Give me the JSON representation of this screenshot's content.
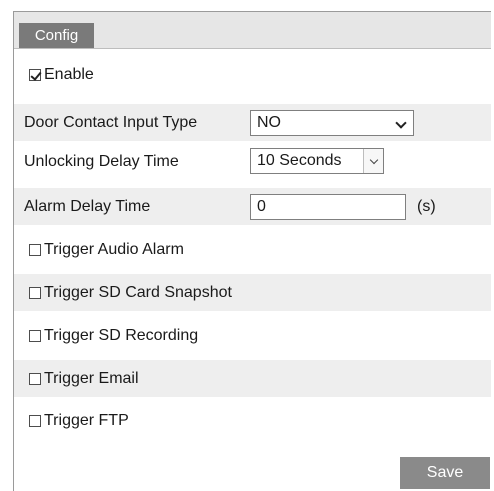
{
  "tab": {
    "label": "Config"
  },
  "enable": {
    "label": "Enable",
    "checked": true
  },
  "door_contact": {
    "label": "Door Contact Input Type",
    "value": "NO"
  },
  "unlocking_delay": {
    "label": "Unlocking Delay Time",
    "value": "10 Seconds"
  },
  "alarm_delay": {
    "label": "Alarm Delay Time",
    "value": "0",
    "unit": "(s)"
  },
  "triggers": [
    {
      "label": "Trigger Audio Alarm",
      "checked": false
    },
    {
      "label": "Trigger SD Card Snapshot",
      "checked": false
    },
    {
      "label": "Trigger SD Recording",
      "checked": false
    },
    {
      "label": "Trigger Email",
      "checked": false
    },
    {
      "label": "Trigger FTP",
      "checked": false
    }
  ],
  "save_label": "Save",
  "colors": {
    "tab_bg": "#7a7a7a",
    "save_bg": "#8a8a8a",
    "row_shade": "#eeeeee"
  }
}
